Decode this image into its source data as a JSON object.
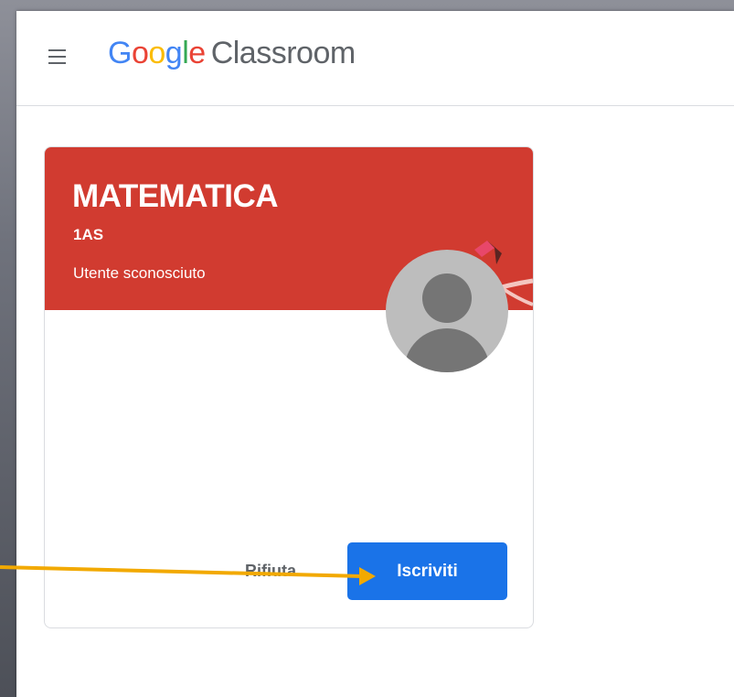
{
  "header": {
    "menu_icon": "hamburger-menu-icon",
    "logo_letters": [
      "G",
      "o",
      "o",
      "g",
      "l",
      "e"
    ],
    "product_name": "Classroom"
  },
  "class_card": {
    "title": "MATEMATICA",
    "section": "1AS",
    "owner": "Utente sconosciuto",
    "header_color": "#d13b30",
    "avatar_icon": "default-avatar-icon",
    "decline_label": "Rifiuta",
    "join_label": "Iscriviti",
    "join_color": "#1a73e8"
  },
  "annotation": {
    "arrow_color": "#f2a900",
    "arrow_icon": "pointer-arrow-icon"
  }
}
